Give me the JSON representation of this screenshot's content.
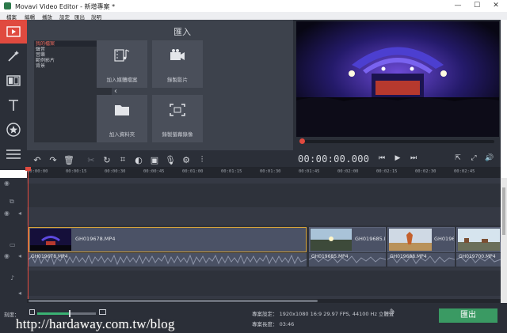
{
  "window": {
    "title": "Movavi Video Editor - 新增專案 *",
    "buttons": {
      "minimize": "—",
      "maximize": "☐",
      "close": "✕"
    }
  },
  "menu": [
    "檔案",
    "編輯",
    "播放",
    "設定",
    "匯出",
    "說明"
  ],
  "rail": {
    "items": [
      {
        "name": "import",
        "icon": "film-import-icon",
        "active": true
      },
      {
        "name": "filters",
        "icon": "magic-wand-icon",
        "active": false
      },
      {
        "name": "transitions",
        "icon": "transition-icon",
        "active": false
      },
      {
        "name": "titles",
        "icon": "text-icon",
        "active": false
      },
      {
        "name": "stickers",
        "icon": "star-icon",
        "active": false
      },
      {
        "name": "more",
        "icon": "menu-lines-icon",
        "active": false
      }
    ]
  },
  "import": {
    "title": "匯入",
    "list": [
      "我的檔案",
      "聲音",
      "音樂",
      "範例影片",
      "背景"
    ],
    "selected_index": 0,
    "tiles": [
      {
        "label": "加入媒體檔案",
        "icon": "media-files-icon"
      },
      {
        "label": "錄製影片",
        "icon": "camera-icon"
      },
      {
        "label": "加入資料夾",
        "icon": "folder-icon"
      },
      {
        "label": "錄製螢幕錄像",
        "icon": "screen-capture-icon"
      }
    ]
  },
  "preview": {
    "timecode": "00:00:00.000",
    "progress": 0.0
  },
  "timeline": {
    "ruler": [
      "00:00:00",
      "00:00:15",
      "00:00:30",
      "00:00:45",
      "00:01:00",
      "00:01:15",
      "00:01:30",
      "00:01:45",
      "00:02:00",
      "00:02:15",
      "00:02:30",
      "00:02:45"
    ],
    "video_clips": [
      {
        "name": "GH019678.MP4",
        "selected": true
      },
      {
        "name": "GH019685.MP4",
        "selected": false
      },
      {
        "name": "GH019688.MP4",
        "selected": false
      },
      {
        "name": "GH019700.MP4",
        "selected": false
      }
    ],
    "audio_clips": [
      {
        "name": "GH019678.MP4"
      },
      {
        "name": "GH019685.MP4"
      },
      {
        "name": "GH019688.MP4"
      },
      {
        "name": "GH019700.MP4"
      }
    ]
  },
  "bottom": {
    "zoom_label": "刻度：",
    "zoom_level": 0.55,
    "settings": "專案設定： 1920x1080 16:9 29.97 FPS, 44100 Hz 立體聲",
    "duration": "專案長度： 03:46",
    "export_label": "匯出"
  },
  "watermark": "http://hardaway.com.tw/blog",
  "colors": {
    "accent": "#e04a3f",
    "export": "#3a9a63",
    "selected_clip_border": "#d9a538",
    "dark_panel": "#2b2f38"
  }
}
